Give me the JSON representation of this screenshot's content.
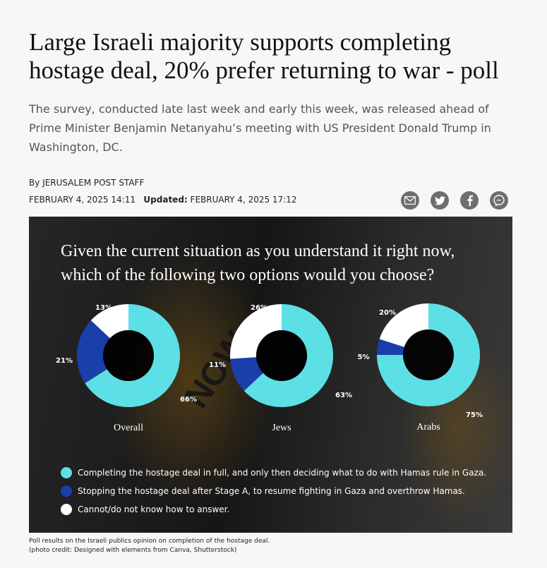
{
  "article": {
    "headline": "Large Israeli majority supports completing hostage deal, 20% prefer returning to war - poll",
    "summary": "The survey, conducted late last week and early this week, was released ahead of Prime Minister Benjamin Netanyahu’s meeting with US President Donald Trump in Washington, DC.",
    "byline": "By JERUSALEM POST STAFF",
    "published": "FEBRUARY 4, 2025 14:11",
    "updated_label": "Updated:",
    "updated": "FEBRUARY 4, 2025 17:12"
  },
  "share_icons": [
    "email-icon",
    "twitter-icon",
    "facebook-icon",
    "messenger-icon"
  ],
  "figure": {
    "background_text": "NOW.",
    "caption_line1": "Poll results on the Israeli publics opinion on completion of the hostage deal.",
    "caption_line2": "(photo credit: Designed with elements from Canva, Shutterstock)"
  },
  "colors": {
    "complete": "#5ce0e6",
    "stop": "#1a3faa",
    "dont_know": "#ffffff"
  },
  "chart_data": {
    "type": "pie",
    "title": "Given the current situation as you understand it right now, which of the following two options would you choose?",
    "categories": [
      "Overall",
      "Jews",
      "Arabs"
    ],
    "series": [
      {
        "name": "Completing the hostage deal in full, and only then deciding what to do with Hamas rule in Gaza.",
        "values": [
          66,
          63,
          75
        ],
        "labels": [
          "66%",
          "63%",
          "75%"
        ]
      },
      {
        "name": "Stopping the hostage deal after Stage A, to resume fighting in Gaza and overthrow Hamas.",
        "values": [
          21,
          11,
          5
        ],
        "labels": [
          "21%",
          "11%",
          "5%"
        ]
      },
      {
        "name": "Cannot/do not know how to answer.",
        "values": [
          13,
          26,
          20
        ],
        "labels": [
          "13%",
          "26%",
          "20%"
        ]
      }
    ],
    "legend_placement": "bottom-left"
  }
}
